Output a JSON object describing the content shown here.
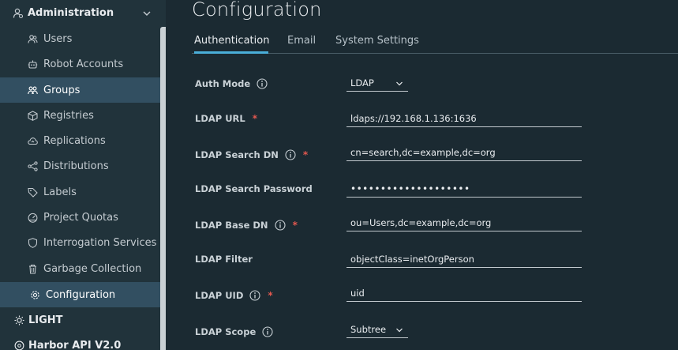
{
  "sidebar": {
    "section_title": "Administration",
    "items": [
      {
        "label": "Users",
        "icon": "users-icon"
      },
      {
        "label": "Robot Accounts",
        "icon": "robot-icon"
      },
      {
        "label": "Groups",
        "icon": "groups-icon"
      },
      {
        "label": "Registries",
        "icon": "cube-icon"
      },
      {
        "label": "Replications",
        "icon": "cloud-icon"
      },
      {
        "label": "Distributions",
        "icon": "share-icon"
      },
      {
        "label": "Labels",
        "icon": "tag-icon"
      },
      {
        "label": "Project Quotas",
        "icon": "dashboard-icon"
      },
      {
        "label": "Interrogation Services",
        "icon": "shield-icon"
      },
      {
        "label": "Garbage Collection",
        "icon": "trash-icon"
      },
      {
        "label": "Configuration",
        "icon": "gear-icon"
      }
    ],
    "theme_label": "LIGHT",
    "api_label": "Harbor API V2.0"
  },
  "page": {
    "title": "Configuration",
    "tabs": [
      "Authentication",
      "Email",
      "System Settings"
    ]
  },
  "form": {
    "auth_mode": {
      "label": "Auth Mode",
      "value": "LDAP"
    },
    "ldap_url": {
      "label": "LDAP URL",
      "value": "ldaps://192.168.1.136:1636"
    },
    "ldap_search_dn": {
      "label": "LDAP Search DN",
      "value": "cn=search,dc=example,dc=org"
    },
    "ldap_search_password": {
      "label": "LDAP Search Password",
      "value": "••••••••••••••••••••"
    },
    "ldap_base_dn": {
      "label": "LDAP Base DN",
      "value": "ou=Users,dc=example,dc=org"
    },
    "ldap_filter": {
      "label": "LDAP Filter",
      "value": "objectClass=inetOrgPerson"
    },
    "ldap_uid": {
      "label": "LDAP UID",
      "value": "uid"
    },
    "ldap_scope": {
      "label": "LDAP Scope",
      "value": "Subtree"
    },
    "required_mark": "*"
  },
  "colors": {
    "background": "#1b2a32",
    "sidebar": "#21333b",
    "active_item": "#324f61",
    "accent": "#4aaed9",
    "required": "#e3584f"
  }
}
